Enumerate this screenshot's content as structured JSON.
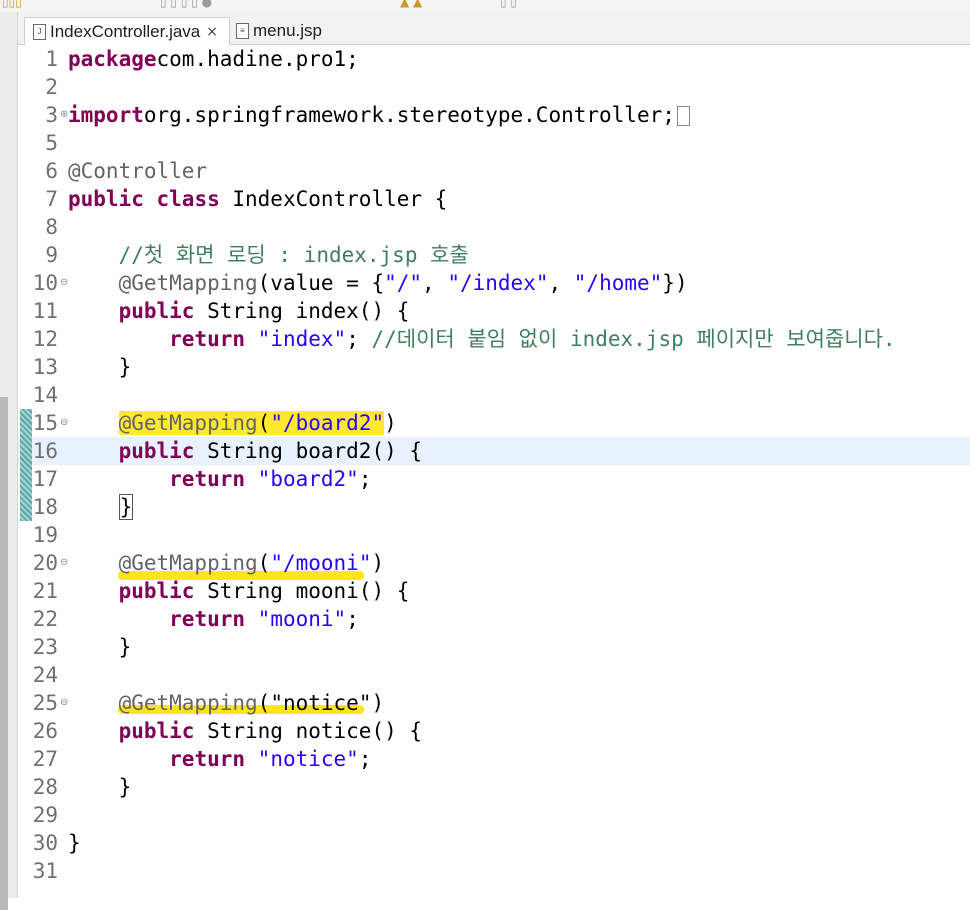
{
  "tabs": [
    {
      "label": "IndexController.java",
      "active": true,
      "close": "×"
    },
    {
      "label": "menu.jsp",
      "active": false
    }
  ],
  "colors": {
    "keyword": "#7f0055",
    "annotation": "#646464",
    "string": "#2a00ff",
    "comment": "#3f7f5f",
    "current_line": "#e8f2fe",
    "occurrence_highlight": "#ffe930",
    "marker": "#ffe51a"
  },
  "icons": [
    "file-icon",
    "fold-icon",
    "change-bar",
    "toolbar-icons"
  ],
  "editor": {
    "current_line": 16,
    "lines": [
      {
        "n": "1",
        "fold": "",
        "segs": [
          [
            "kw",
            "package"
          ],
          [
            "",
            "com.hadine.pro1;"
          ]
        ]
      },
      {
        "n": "2",
        "fold": "",
        "segs": []
      },
      {
        "n": "3",
        "fold": "⊕",
        "segs": [
          [
            "kw",
            "import"
          ],
          [
            "",
            "org.springframework.stereotype.Controller;"
          ],
          [
            "fb",
            ""
          ]
        ]
      },
      {
        "n": "5",
        "fold": "",
        "segs": []
      },
      {
        "n": "6",
        "fold": "",
        "segs": [
          [
            "ann",
            "@Controller"
          ]
        ]
      },
      {
        "n": "7",
        "fold": "",
        "segs": [
          [
            "kw",
            "public"
          ],
          [
            "",
            " "
          ],
          [
            "kw",
            "class"
          ],
          [
            "",
            " IndexController {"
          ]
        ]
      },
      {
        "n": "8",
        "fold": "",
        "segs": []
      },
      {
        "n": "9",
        "fold": "",
        "segs": [
          [
            "",
            "    "
          ],
          [
            "cmt",
            "//첫 화면 로딩 : index.jsp 호출"
          ]
        ]
      },
      {
        "n": "10",
        "fold": "⊖",
        "segs": [
          [
            "",
            "    "
          ],
          [
            "ann",
            "@GetMapping"
          ],
          [
            "",
            "(value = {"
          ],
          [
            "str",
            "\"/\""
          ],
          [
            "",
            ", "
          ],
          [
            "str",
            "\"/index\""
          ],
          [
            "",
            ", "
          ],
          [
            "str",
            "\"/home\""
          ],
          [
            "",
            "})"
          ]
        ]
      },
      {
        "n": "11",
        "fold": "",
        "segs": [
          [
            "",
            "    "
          ],
          [
            "kw",
            "public"
          ],
          [
            "",
            " String index() {"
          ]
        ]
      },
      {
        "n": "12",
        "fold": "",
        "segs": [
          [
            "",
            "        "
          ],
          [
            "kw",
            "return"
          ],
          [
            "",
            " "
          ],
          [
            "str",
            "\"index\""
          ],
          [
            "",
            "; "
          ],
          [
            "cmt",
            "//데이터 붙임 없이 index.jsp 페이지만 보여줍니다."
          ]
        ]
      },
      {
        "n": "13",
        "fold": "",
        "segs": [
          [
            "",
            "    }"
          ]
        ]
      },
      {
        "n": "14",
        "fold": "",
        "segs": []
      },
      {
        "n": "15",
        "fold": "⊖",
        "segs": [
          [
            "",
            "    "
          ],
          [
            "ann hl",
            "@GetMapping"
          ],
          [
            "hl",
            "("
          ],
          [
            "str hl",
            "\"/board2\""
          ],
          [
            "",
            ")"
          ]
        ]
      },
      {
        "n": "16",
        "fold": "",
        "segs": [
          [
            "",
            "    "
          ],
          [
            "kw",
            "public"
          ],
          [
            "",
            " String board2() {"
          ]
        ]
      },
      {
        "n": "17",
        "fold": "",
        "segs": [
          [
            "",
            "        "
          ],
          [
            "kw",
            "return"
          ],
          [
            "",
            " "
          ],
          [
            "str",
            "\"board2\""
          ],
          [
            "",
            ";"
          ]
        ]
      },
      {
        "n": "18",
        "fold": "",
        "segs": [
          [
            "",
            "    "
          ],
          [
            "box",
            "}"
          ]
        ]
      },
      {
        "n": "19",
        "fold": "",
        "segs": []
      },
      {
        "n": "20",
        "fold": "⊖",
        "segs": [
          [
            "",
            "    "
          ],
          [
            "ann",
            "@GetMapping"
          ],
          [
            "",
            "("
          ],
          [
            "str",
            "\"/mooni\""
          ],
          [
            "",
            ")"
          ]
        ]
      },
      {
        "n": "21",
        "fold": "",
        "segs": [
          [
            "",
            "    "
          ],
          [
            "kw",
            "public"
          ],
          [
            "",
            " String mooni() {"
          ]
        ]
      },
      {
        "n": "22",
        "fold": "",
        "segs": [
          [
            "",
            "        "
          ],
          [
            "kw",
            "return"
          ],
          [
            "",
            " "
          ],
          [
            "str",
            "\"mooni\""
          ],
          [
            "",
            ";"
          ]
        ]
      },
      {
        "n": "23",
        "fold": "",
        "segs": [
          [
            "",
            "    }"
          ]
        ]
      },
      {
        "n": "24",
        "fold": "",
        "segs": []
      },
      {
        "n": "25",
        "fold": "⊖",
        "segs": [
          [
            "",
            "    "
          ],
          [
            "ann",
            "@GetMapping"
          ],
          [
            "",
            "("
          ],
          [
            "",
            "\"notice\""
          ],
          [
            "",
            ")"
          ]
        ]
      },
      {
        "n": "26",
        "fold": "",
        "segs": [
          [
            "",
            "    "
          ],
          [
            "kw",
            "public"
          ],
          [
            "",
            " String notice() {"
          ]
        ]
      },
      {
        "n": "27",
        "fold": "",
        "segs": [
          [
            "",
            "        "
          ],
          [
            "kw",
            "return"
          ],
          [
            "",
            " "
          ],
          [
            "str",
            "\"notice\""
          ],
          [
            "",
            ";"
          ]
        ]
      },
      {
        "n": "28",
        "fold": "",
        "segs": [
          [
            "",
            "    }"
          ]
        ]
      },
      {
        "n": "29",
        "fold": "",
        "segs": []
      },
      {
        "n": "30",
        "fold": "",
        "segs": [
          [
            "",
            "}"
          ]
        ]
      },
      {
        "n": "31",
        "fold": "",
        "segs": []
      }
    ]
  }
}
